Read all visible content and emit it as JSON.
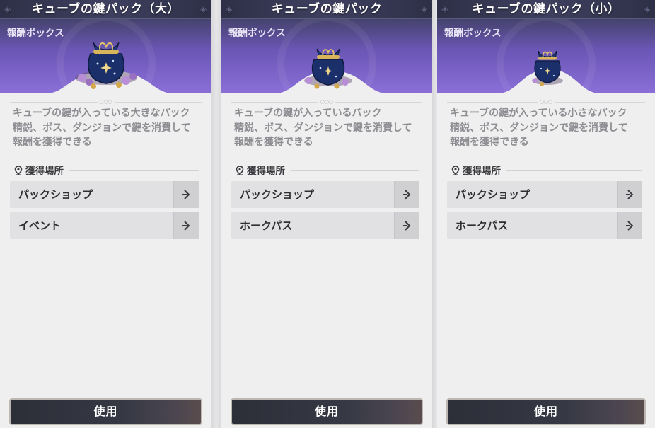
{
  "panels": [
    {
      "title": "キューブの鍵パック（大）",
      "category": "報酬ボックス",
      "item_icon": "large-key-pouch-icon",
      "description": [
        "キューブの鍵が入っている大きなパック",
        "精鋭、ボス、ダンジョンで鍵を消費して",
        "報酬を獲得できる"
      ],
      "sources_title": "獲得場所",
      "sources": [
        {
          "label": "パックショップ"
        },
        {
          "label": "イベント"
        }
      ],
      "use_label": "使用"
    },
    {
      "title": "キューブの鍵パック",
      "category": "報酬ボックス",
      "item_icon": "medium-key-pouch-icon",
      "description": [
        "キューブの鍵が入っているパック",
        "精鋭、ボス、ダンジョンで鍵を消費して",
        "報酬を獲得できる"
      ],
      "sources_title": "獲得場所",
      "sources": [
        {
          "label": "パックショップ"
        },
        {
          "label": "ホークパス"
        }
      ],
      "use_label": "使用"
    },
    {
      "title": "キューブの鍵パック（小）",
      "category": "報酬ボックス",
      "item_icon": "small-key-pouch-icon",
      "description": [
        "キューブの鍵が入っている小さなパック",
        "精鋭、ボス、ダンジョンで鍵を消費して",
        "報酬を獲得できる"
      ],
      "sources_title": "獲得場所",
      "sources": [
        {
          "label": "パックショップ"
        },
        {
          "label": "ホークパス"
        }
      ],
      "use_label": "使用"
    }
  ],
  "colors": {
    "header_top": "#3c3d5c",
    "header_bottom": "#8a6fd8",
    "panel_bg": "#efeff0",
    "text_muted": "#8d8d92",
    "button_dark": "#2c2e38"
  }
}
